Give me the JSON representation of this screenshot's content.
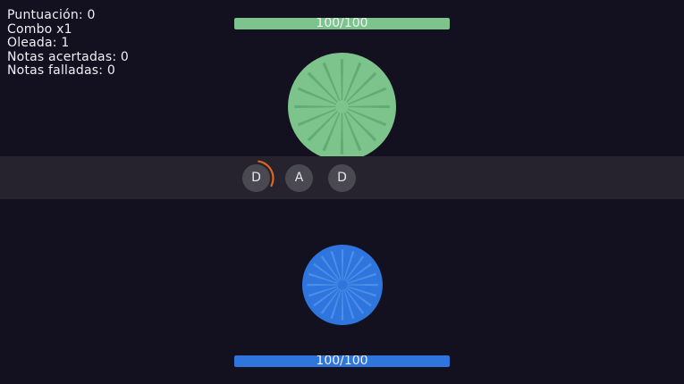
{
  "stats": {
    "score": "Puntuación: 0",
    "combo": "Combo x1",
    "wave": "Oleada: 1",
    "hits": "Notas acertadas: 0",
    "misses": "Notas falladas: 0"
  },
  "enemy": {
    "hp_text": "100/100",
    "hp_fraction": 1.0,
    "color": "#7cc48c",
    "spoke_color": "#63ab74"
  },
  "player": {
    "hp_text": "100/100",
    "hp_fraction": 1.0,
    "color": "#2e76dd",
    "spoke_color": "#4d8fe8"
  },
  "note_lane": {
    "notes": [
      "D",
      "A",
      "D"
    ],
    "timing_ring_color": "#e0651e",
    "timing_ring_progress": 0.3
  }
}
